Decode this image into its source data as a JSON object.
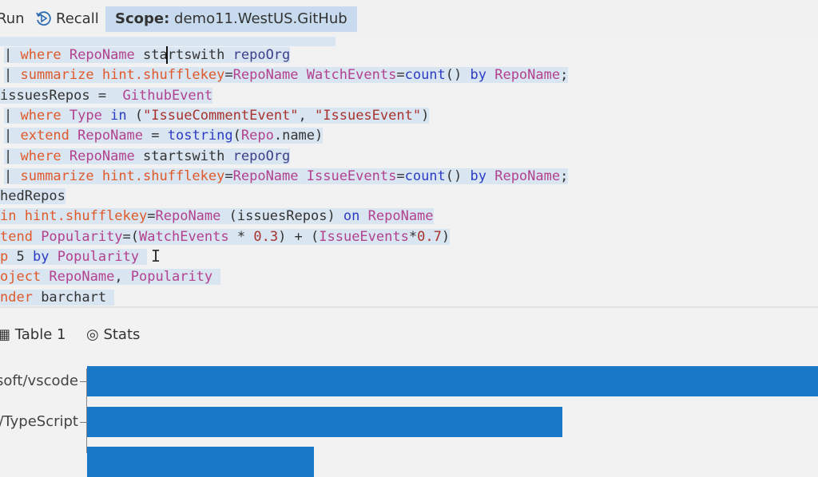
{
  "toolbar": {
    "run_label": "Run",
    "recall_label": "Recall",
    "scope_label": "Scope:",
    "scope_value": "demo11.WestUS.GitHub"
  },
  "editor": {
    "lines": [
      [
        [
          "| ",
          "p"
        ],
        [
          "where ",
          "k"
        ],
        [
          "RepoName ",
          "c"
        ],
        [
          "startswith ",
          "p"
        ],
        [
          "repoOrg",
          "v"
        ]
      ],
      [
        [
          "| ",
          "p"
        ],
        [
          "summarize ",
          "k"
        ],
        [
          "hint.shufflekey",
          "k"
        ],
        [
          "=",
          "p"
        ],
        [
          "RepoName ",
          "c"
        ],
        [
          "WatchEvents",
          "c"
        ],
        [
          "=",
          "p"
        ],
        [
          "count",
          "b"
        ],
        [
          "() ",
          "p"
        ],
        [
          "by ",
          "b"
        ],
        [
          "RepoName",
          "c"
        ],
        [
          ";",
          "p"
        ]
      ],
      [
        [
          "issuesRepos =  ",
          "p"
        ],
        [
          "GithubEvent",
          "c"
        ]
      ],
      [
        [
          "| ",
          "p"
        ],
        [
          "where ",
          "k"
        ],
        [
          "Type ",
          "c"
        ],
        [
          "in ",
          "b"
        ],
        [
          "(",
          "p"
        ],
        [
          "\"IssueCommentEvent\"",
          "s"
        ],
        [
          ", ",
          "p"
        ],
        [
          "\"IssuesEvent\"",
          "s"
        ],
        [
          ")",
          "p"
        ]
      ],
      [
        [
          "| ",
          "p"
        ],
        [
          "extend ",
          "k"
        ],
        [
          "RepoName ",
          "c"
        ],
        [
          "= ",
          "p"
        ],
        [
          "tostring",
          "b"
        ],
        [
          "(",
          "p"
        ],
        [
          "Repo",
          "c"
        ],
        [
          ".name)",
          "p"
        ]
      ],
      [
        [
          "| ",
          "p"
        ],
        [
          "where ",
          "k"
        ],
        [
          "RepoName ",
          "c"
        ],
        [
          "startswith ",
          "p"
        ],
        [
          "repoOrg",
          "v"
        ]
      ],
      [
        [
          "| ",
          "p"
        ],
        [
          "summarize ",
          "k"
        ],
        [
          "hint.shufflekey",
          "k"
        ],
        [
          "=",
          "p"
        ],
        [
          "RepoName ",
          "c"
        ],
        [
          "IssueEvents",
          "c"
        ],
        [
          "=",
          "p"
        ],
        [
          "count",
          "b"
        ],
        [
          "() ",
          "p"
        ],
        [
          "by ",
          "b"
        ],
        [
          "RepoName",
          "c"
        ],
        [
          ";",
          "p"
        ]
      ],
      [
        [
          "hedRepos",
          "p"
        ]
      ],
      [
        [
          "in ",
          "k"
        ],
        [
          "hint.shufflekey",
          "k"
        ],
        [
          "=",
          "p"
        ],
        [
          "RepoName ",
          "c"
        ],
        [
          "(issuesRepos) ",
          "p"
        ],
        [
          "on ",
          "b"
        ],
        [
          "RepoName",
          "c"
        ]
      ],
      [
        [
          "tend ",
          "k"
        ],
        [
          "Popularity",
          "c"
        ],
        [
          "=(",
          "p"
        ],
        [
          "WatchEvents ",
          "c"
        ],
        [
          "* ",
          "p"
        ],
        [
          "0.3",
          "n"
        ],
        [
          ") + (",
          "p"
        ],
        [
          "IssueEvents",
          "c"
        ],
        [
          "*",
          "p"
        ],
        [
          "0.7",
          "n"
        ],
        [
          ")",
          "p"
        ]
      ],
      [
        [
          "p ",
          "k"
        ],
        [
          "5 ",
          "p"
        ],
        [
          "by ",
          "b"
        ],
        [
          "Popularity ",
          "c"
        ]
      ],
      [
        [
          "oject ",
          "k"
        ],
        [
          "RepoName",
          "c"
        ],
        [
          ", ",
          "p"
        ],
        [
          "Popularity ",
          "c"
        ]
      ],
      [
        [
          "nder ",
          "k"
        ],
        [
          "barchart ",
          "p"
        ]
      ]
    ]
  },
  "results": {
    "tabs": [
      {
        "label": "Table 1",
        "icon": "table-icon"
      },
      {
        "label": "Stats",
        "icon": "stats-icon"
      }
    ]
  },
  "chart_data": {
    "type": "bar",
    "orientation": "horizontal",
    "categories": [
      "soft/vscode",
      "t/TypeScript",
      ""
    ],
    "values": [
      1.0,
      0.65,
      0.31
    ],
    "color": "#1a78c8",
    "xlabel": "",
    "ylabel": ""
  }
}
